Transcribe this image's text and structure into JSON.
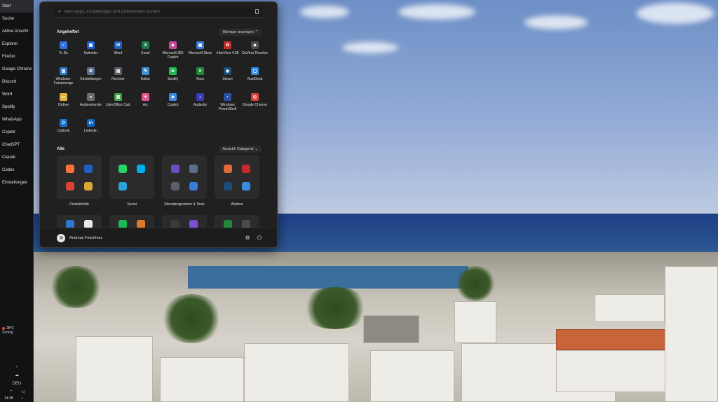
{
  "taskbar": {
    "items": [
      {
        "label": "Start",
        "name": "taskbar-item-start"
      },
      {
        "label": "Suche",
        "name": "taskbar-item-suche"
      },
      {
        "label": "Aktive Ansicht",
        "name": "taskbar-item-aktive-ansicht"
      },
      {
        "label": "Explorer",
        "name": "taskbar-item-explorer"
      },
      {
        "label": "Firefox",
        "name": "taskbar-item-firefox"
      },
      {
        "label": "Google Chrome",
        "name": "taskbar-item-google-chrome"
      },
      {
        "label": "Discord",
        "name": "taskbar-item-discord"
      },
      {
        "label": "Word",
        "name": "taskbar-item-word"
      },
      {
        "label": "Spotify",
        "name": "taskbar-item-spotify"
      },
      {
        "label": "WhatsApp",
        "name": "taskbar-item-whatsapp"
      },
      {
        "label": "Copilot",
        "name": "taskbar-item-copilot"
      },
      {
        "label": "ChatGPT",
        "name": "taskbar-item-chatgpt"
      },
      {
        "label": "Claude",
        "name": "taskbar-item-claude"
      },
      {
        "label": "Codex",
        "name": "taskbar-item-codex"
      },
      {
        "label": "Einstellungen",
        "name": "taskbar-item-einstellungen"
      }
    ],
    "weather_temp": "28°C",
    "weather_desc": "Sonnig",
    "language": "DEU",
    "time": "14:28"
  },
  "start_menu": {
    "search_placeholder": "Nach Apps, Einstellungen und Dokumenten suchen",
    "pinned_title": "Angeheftet",
    "pinned_toggle": "Weniger anzeigen",
    "pinned": [
      {
        "label": "To Do",
        "icon": "todo-icon",
        "color": "#2f6fe0",
        "glyph": "✓"
      },
      {
        "label": "Kalender",
        "icon": "calendar-icon",
        "color": "#1e5bd8",
        "glyph": "▦"
      },
      {
        "label": "Word",
        "icon": "word-icon",
        "color": "#1f5fc4",
        "glyph": "W"
      },
      {
        "label": "Excel",
        "icon": "excel-icon",
        "color": "#1d7a45",
        "glyph": "X"
      },
      {
        "label": "Microsoft 365 Copilot",
        "icon": "m365-copilot-icon",
        "color": "#c4479a",
        "glyph": "◈"
      },
      {
        "label": "Microsoft Store",
        "icon": "store-icon",
        "color": "#3a7bd5",
        "glyph": "▣"
      },
      {
        "label": "IrfanView 4.58",
        "icon": "irfanview-icon",
        "color": "#c42b2b",
        "glyph": "✿"
      },
      {
        "label": "DaVinci Resolve",
        "icon": "davinci-icon",
        "color": "#4a4a52",
        "glyph": "◆"
      },
      {
        "label": "Windows-Fotoanzeige",
        "icon": "photo-viewer-icon",
        "color": "#2e78d2",
        "glyph": "▧"
      },
      {
        "label": "Einstellungen",
        "icon": "settings-icon",
        "color": "#5a6f8f",
        "glyph": "⚙"
      },
      {
        "label": "Rechner",
        "icon": "calculator-icon",
        "color": "#5a5f6a",
        "glyph": "▤"
      },
      {
        "label": "Editor",
        "icon": "notepad-icon",
        "color": "#3f8fd1",
        "glyph": "✎"
      },
      {
        "label": "Spotify",
        "icon": "spotify-icon",
        "color": "#1db954",
        "glyph": "≋"
      },
      {
        "label": "Xbox",
        "icon": "xbox-icon",
        "color": "#1f8a3a",
        "glyph": "✕"
      },
      {
        "label": "Steam",
        "icon": "steam-icon",
        "color": "#1b4d7a",
        "glyph": "◉"
      },
      {
        "label": "RustDesk",
        "icon": "rustdesk-icon",
        "color": "#2d8fe6",
        "glyph": "▢"
      },
      {
        "label": "Ordner",
        "icon": "folder-icon",
        "color": "#e2b23a",
        "glyph": "▭"
      },
      {
        "label": "Audiorekorder",
        "icon": "microphone-icon",
        "color": "#6b6b70",
        "glyph": "●"
      },
      {
        "label": "LibreOffice Calc",
        "icon": "libreoffice-calc-icon",
        "color": "#3fa34d",
        "glyph": "▥"
      },
      {
        "label": "Arc",
        "icon": "arc-icon",
        "color": "#e05690",
        "glyph": "✦"
      },
      {
        "label": "Copilot",
        "icon": "copilot-icon",
        "color": "#3a8ae0",
        "glyph": "◈"
      },
      {
        "label": "Audacity",
        "icon": "audacity-icon",
        "color": "#3b3bb8",
        "glyph": "◒"
      },
      {
        "label": "Windows PowerShell",
        "icon": "powershell-icon",
        "color": "#2c4fa3",
        "glyph": "›"
      },
      {
        "label": "Google Chrome",
        "icon": "chrome-icon",
        "color": "#db4437",
        "glyph": "◎"
      },
      {
        "label": "Outlook",
        "icon": "outlook-icon",
        "color": "#1c6fd1",
        "glyph": "O"
      },
      {
        "label": "LinkedIn",
        "icon": "linkedin-icon",
        "color": "#0a66c2",
        "glyph": "in"
      }
    ],
    "all_title": "Alle",
    "all_toggle": "Ansicht: Kategorie",
    "categories": [
      {
        "label": "Produktivität",
        "icons": [
          {
            "icon": "firefox-icon",
            "color": "#ff7139"
          },
          {
            "icon": "word-icon",
            "color": "#1f5fc4"
          },
          {
            "icon": "chrome-icon",
            "color": "#db4437"
          },
          {
            "icon": "office-apps-icon",
            "color": "#d9a82e"
          }
        ]
      },
      {
        "label": "Social",
        "icons": [
          {
            "icon": "whatsapp-icon",
            "color": "#25d366"
          },
          {
            "icon": "skype-icon",
            "color": "#00aff0"
          },
          {
            "icon": "telegram-icon",
            "color": "#2aa1d9"
          },
          {
            "icon": "empty-slot-icon",
            "color": "#2b2b2b"
          }
        ]
      },
      {
        "label": "Dienstprogramme & Tools",
        "icons": [
          {
            "icon": "snipping-tool-icon",
            "color": "#6a4fc4"
          },
          {
            "icon": "settings-icon",
            "color": "#5a6f8f"
          },
          {
            "icon": "calculator-icon",
            "color": "#5a5f6a"
          },
          {
            "icon": "tools-group-icon",
            "color": "#3a7bd5"
          }
        ]
      },
      {
        "label": "Weitere",
        "icons": [
          {
            "icon": "app-orange-icon",
            "color": "#e06a3a"
          },
          {
            "icon": "app-red-icon",
            "color": "#c42b2b"
          },
          {
            "icon": "steam-icon",
            "color": "#1b4d7a"
          },
          {
            "icon": "more-apps-icon",
            "color": "#3a8ae0"
          }
        ]
      },
      {
        "label": "",
        "icons": [
          {
            "icon": "photo-viewer-icon",
            "color": "#2e78d2"
          },
          {
            "icon": "capcut-icon",
            "color": "#e8e8e8"
          }
        ]
      },
      {
        "label": "",
        "icons": [
          {
            "icon": "spotify-icon",
            "color": "#1db954"
          },
          {
            "icon": "media-player-icon",
            "color": "#e07a2a"
          }
        ]
      },
      {
        "label": "",
        "icons": [
          {
            "icon": "terminal-icon",
            "color": "#3a3a3a"
          },
          {
            "icon": "app-purple-icon",
            "color": "#7a4fd6"
          }
        ]
      },
      {
        "label": "",
        "icons": [
          {
            "icon": "xbox-icon",
            "color": "#1f8a3a"
          },
          {
            "icon": "app-dark-icon",
            "color": "#4a4a52"
          }
        ]
      }
    ],
    "user_name": "Andreas Frischholz"
  }
}
